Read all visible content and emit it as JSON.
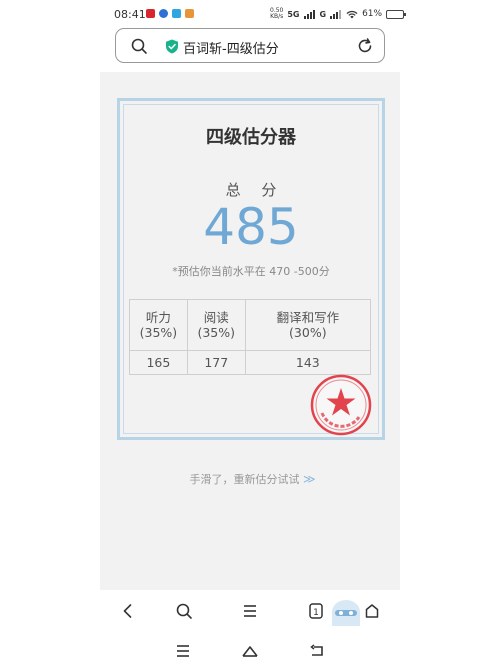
{
  "status": {
    "time": "08:41",
    "net_speed_value": "0.50",
    "net_speed_unit": "KB/s",
    "sig1": "5G",
    "sig2": "G",
    "battery_pct": "61%",
    "battery_level": 0.61
  },
  "address_bar": {
    "title": "百词斩-四级估分"
  },
  "card": {
    "title": "四级估分器",
    "total_label": "总 分",
    "score": "485",
    "estimate_text": "*预估你当前水平在 470 -500分",
    "table": {
      "headers": [
        {
          "line1": "听力",
          "line2": "(35%)"
        },
        {
          "line1": "阅读",
          "line2": "(35%)"
        },
        {
          "line1": "翻译和写作",
          "line2": "(30%)"
        }
      ],
      "values": [
        "165",
        "177",
        "143"
      ]
    }
  },
  "retry": {
    "label": "手滑了，重新估分试试",
    "arrows": "≫"
  },
  "colors": {
    "accent": "#6fa8d4",
    "card_border": "#b7d3e6",
    "stamp": "#e2434d",
    "shield": "#19b38b"
  },
  "icons": {
    "toolbar": [
      "back-icon",
      "search-icon",
      "menu-icon",
      "tabs-icon",
      "home-icon"
    ],
    "sysnav": [
      "recent-apps-icon",
      "home-icon",
      "back-icon"
    ]
  }
}
